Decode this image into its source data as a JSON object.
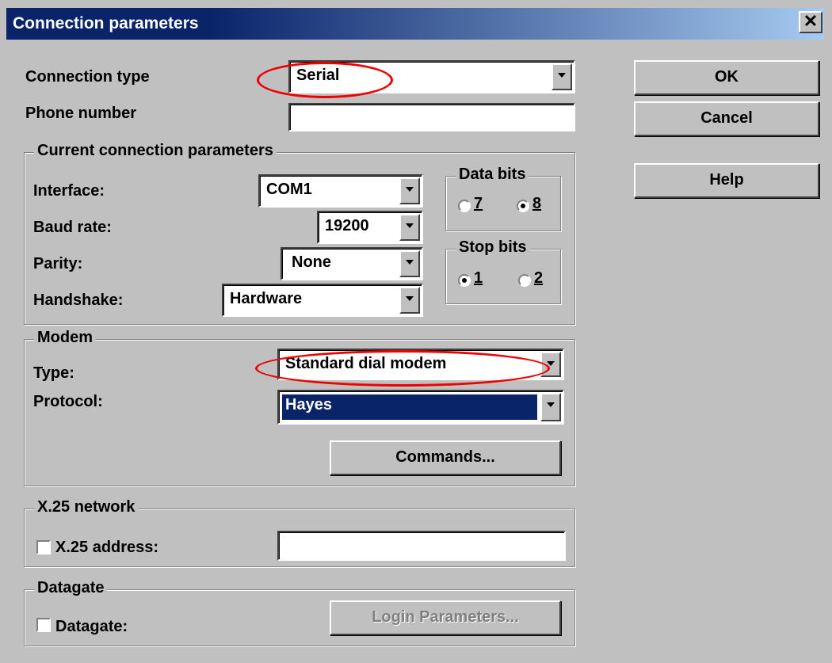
{
  "window": {
    "title": "Connection parameters",
    "close_glyph": "✕"
  },
  "main": {
    "connection_type_label": "Connection type",
    "connection_type_value": "Serial",
    "phone_number_label": "Phone number",
    "phone_number_value": ""
  },
  "buttons": {
    "ok": "OK",
    "cancel": "Cancel",
    "help": "Help"
  },
  "current": {
    "legend": "Current connection parameters",
    "interface_label": "Interface:",
    "interface_value": "COM1",
    "baud_label": "Baud rate:",
    "baud_value": "19200",
    "parity_label": "Parity:",
    "parity_value": "None",
    "handshake_label": "Handshake:",
    "handshake_value": "Hardware",
    "data_bits": {
      "legend": "Data bits",
      "opt1": "7",
      "opt2": "8",
      "selected": "8"
    },
    "stop_bits": {
      "legend": "Stop bits",
      "opt1": "1",
      "opt2": "2",
      "selected": "1"
    }
  },
  "modem": {
    "legend": "Modem",
    "type_label": "Type:",
    "type_value": "Standard dial modem",
    "protocol_label": "Protocol:",
    "protocol_value": "Hayes",
    "commands_button": "Commands..."
  },
  "x25": {
    "legend": "X.25 network",
    "address_label": "X.25 address:",
    "address_value": "",
    "checked": false
  },
  "datagate": {
    "legend": "Datagate",
    "label": "Datagate:",
    "checked": false,
    "login_button": "Login Parameters..."
  },
  "colors": {
    "highlight_ellipse": "#e00000",
    "selection": "#0a246a",
    "title_gradient_start": "#0a246a",
    "title_gradient_end": "#a6caf0"
  }
}
